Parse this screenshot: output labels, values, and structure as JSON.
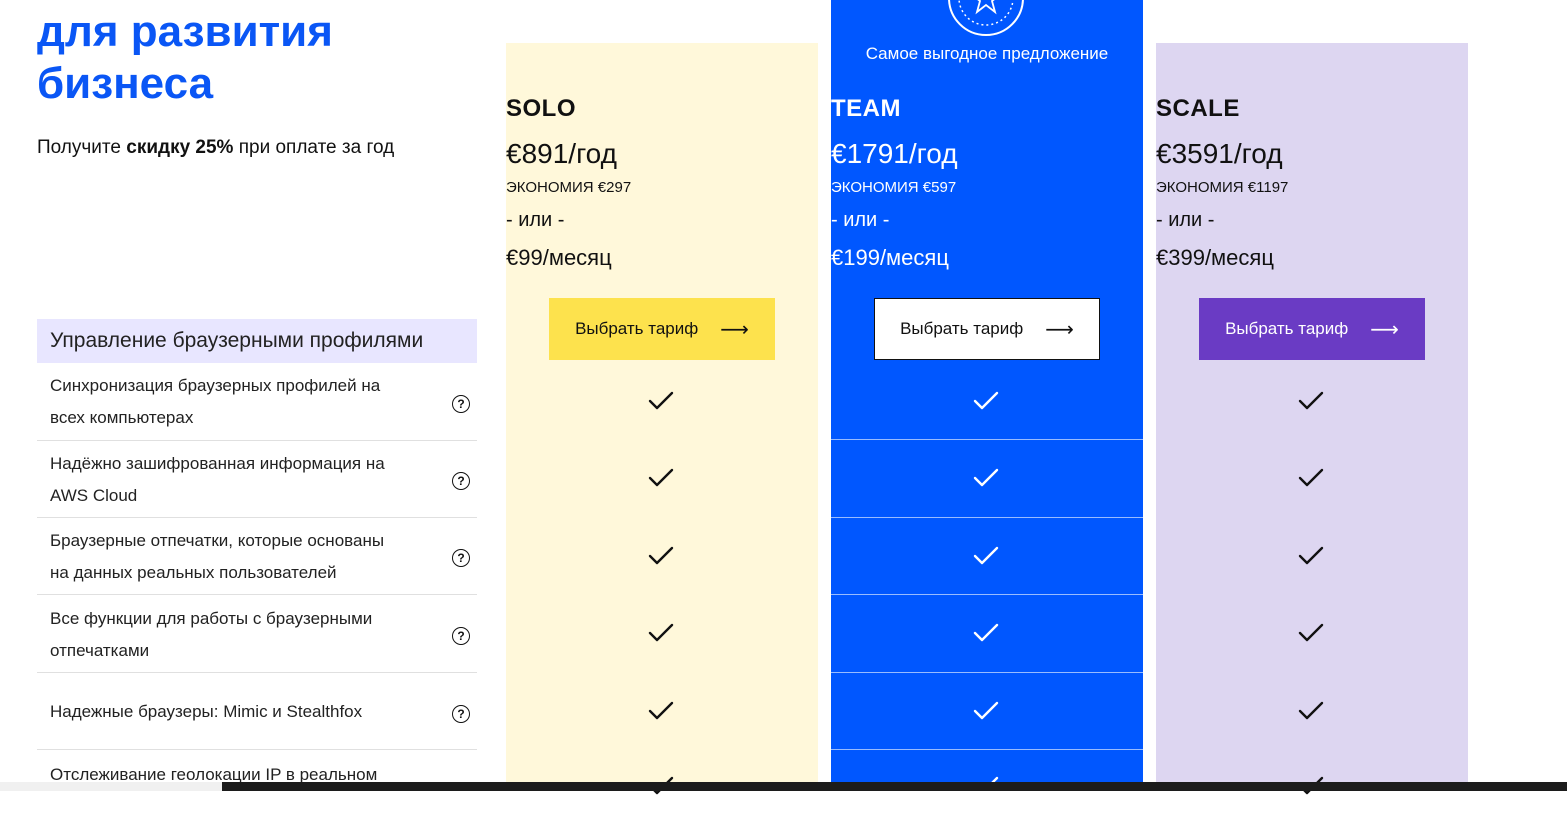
{
  "hero": {
    "title_line1": "для развития",
    "title_line2": "бизнеса",
    "subtitle_pre": "Получите ",
    "subtitle_bold": "скидку 25%",
    "subtitle_post": " при оплате за год"
  },
  "best_offer_label": "Самое выгодное предложение",
  "plans": [
    {
      "name": "SOLO",
      "yearly": "€891/год",
      "saving": "ЭКОНОМИЯ €297",
      "or": "- или -",
      "monthly": "€99/месяц",
      "button": "Выбрать тариф"
    },
    {
      "name": "TEAM",
      "yearly": "€1791/год",
      "saving": "ЭКОНОМИЯ €597",
      "or": "- или -",
      "monthly": "€199/месяц",
      "button": "Выбрать тариф"
    },
    {
      "name": "SCALE",
      "yearly": "€3591/год",
      "saving": "ЭКОНОМИЯ €1197",
      "or": "- или -",
      "monthly": "€399/месяц",
      "button": "Выбрать тариф"
    }
  ],
  "section": {
    "title": "Управление браузерными профилями"
  },
  "features": [
    {
      "l1": "Синхронизация браузерных профилей на",
      "l2": "всех компьютерах"
    },
    {
      "l1": "Надёжно зашифрованная информация на",
      "l2": "AWS Cloud"
    },
    {
      "l1": "Браузерные отпечатки, которые основаны",
      "l2": "на данных реальных пользователей"
    },
    {
      "l1": "Все функции для работы с браузерными",
      "l2": "отпечатками"
    },
    {
      "l1": "Надежные браузеры: Mimic и Stealthfox",
      "l2": ""
    },
    {
      "l1": "Отслеживание геолокации IP в реальном",
      "l2": ""
    }
  ],
  "icons": {
    "help": "question-circle-icon",
    "check": "check-icon",
    "arrow": "arrow-right-icon",
    "badge": "star-badge-icon"
  },
  "colors": {
    "brand_blue": "#0057ff",
    "solo_bg": "#fff8da",
    "scale_bg": "#ddd6f1",
    "solo_button": "#fde24d",
    "scale_button": "#6a3bc4"
  }
}
